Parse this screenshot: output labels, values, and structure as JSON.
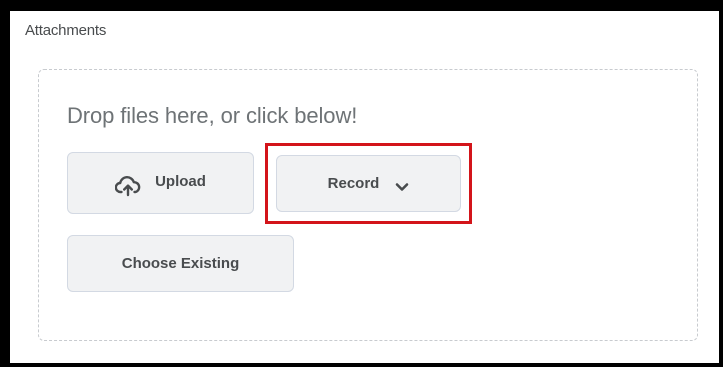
{
  "attachments": {
    "title": "Attachments",
    "drop_text": "Drop files here, or click below!",
    "upload_label": "Upload",
    "upload_icon": "cloud-upload-icon",
    "record_label": "Record",
    "record_icon": "chevron-down-icon",
    "choose_existing_label": "Choose Existing"
  },
  "highlight": {
    "color": "#d3141a",
    "target": "Record"
  }
}
